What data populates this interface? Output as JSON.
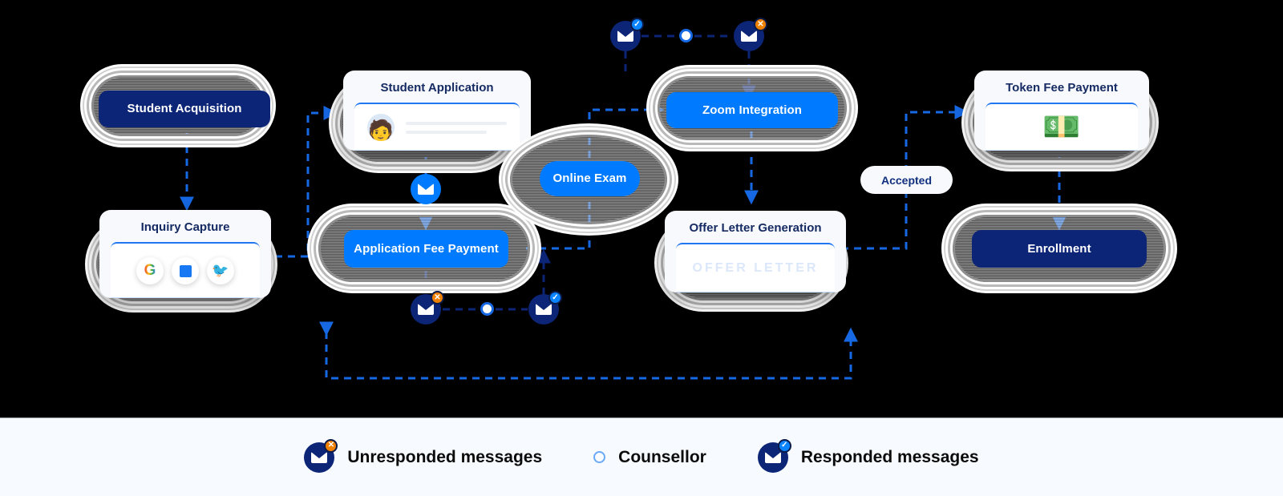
{
  "nodes": {
    "student_acquisition": {
      "label": "Student Acquisition",
      "style": "navy-pill"
    },
    "inquiry_capture": {
      "label": "Inquiry Capture",
      "style": "card",
      "icons": [
        "google-icon",
        "facebook-icon",
        "twitter-icon"
      ],
      "google_glyph": "G",
      "twitter_glyph": "🐦"
    },
    "student_application": {
      "label": "Student Application",
      "style": "card",
      "avatar_glyph": "🧑"
    },
    "application_fee_payment": {
      "label": "Application Fee Payment",
      "style": "blue-pill"
    },
    "online_exam": {
      "label": "Online Exam",
      "style": "blue-round-pill-in-oval"
    },
    "zoom_integration": {
      "label": "Zoom Integration",
      "style": "blue-pill"
    },
    "offer_letter_generation": {
      "label": "Offer Letter Generation",
      "style": "card",
      "watermark": "OFFER LETTER"
    },
    "token_fee_payment": {
      "label": "Token Fee Payment",
      "style": "card",
      "money_glyph": "💵"
    },
    "enrollment": {
      "label": "Enrollment",
      "style": "navy-pill"
    }
  },
  "edge_labels": {
    "accepted": "Accepted"
  },
  "message_badges": [
    {
      "name": "top-left-badge",
      "status": "responded",
      "mark": "✓"
    },
    {
      "name": "top-right-badge",
      "status": "unresponded",
      "mark": "✕"
    },
    {
      "name": "bottom-left-badge",
      "status": "unresponded",
      "mark": "✕"
    },
    {
      "name": "bottom-right-badge",
      "status": "responded",
      "mark": "✓"
    }
  ],
  "legend": {
    "items": [
      {
        "icon": "unresponded-message-icon",
        "label": "Unresponded messages",
        "mark": "✕"
      },
      {
        "icon": "counsellor-icon",
        "label": "Counsellor"
      },
      {
        "icon": "responded-message-icon",
        "label": "Responded messages",
        "mark": "✓"
      }
    ]
  },
  "colors": {
    "navy": "#0c2577",
    "blue": "#007bff",
    "edge": "#1668e3",
    "edge_dark": "#0c2577",
    "badge_ok": "#0a84ff",
    "badge_no": "#f08000",
    "canvas": "#000000",
    "legend_bg": "#f7faff"
  }
}
